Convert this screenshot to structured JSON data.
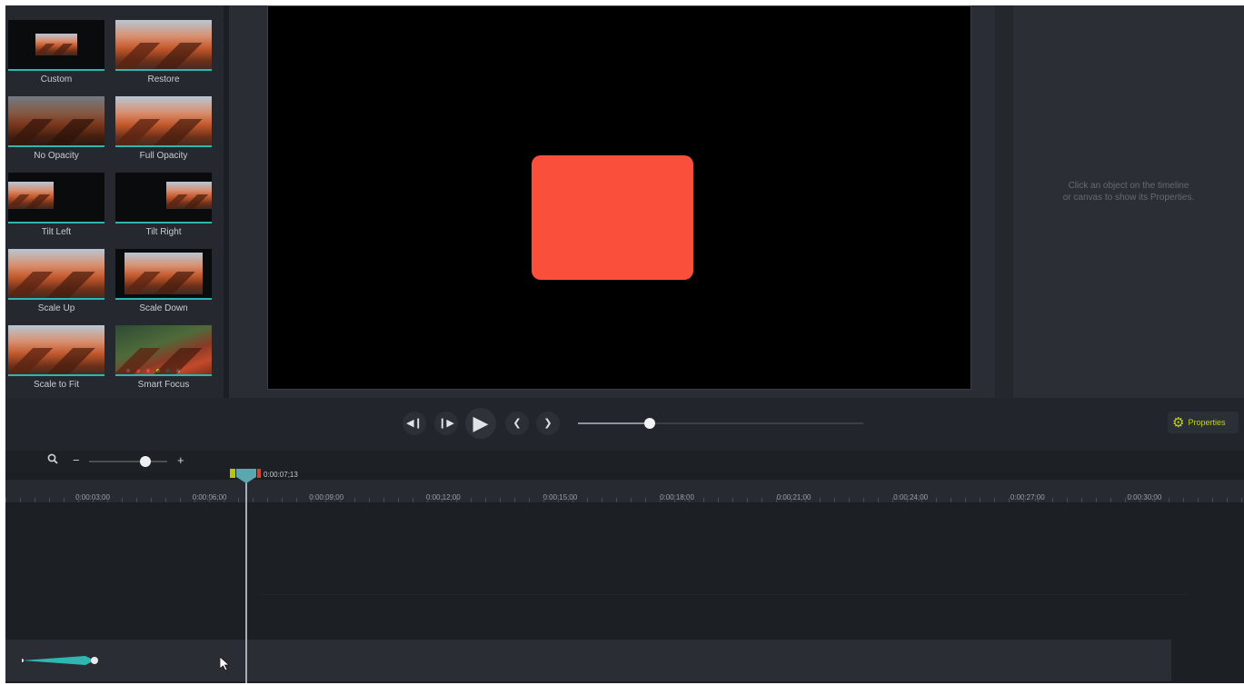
{
  "animations": [
    {
      "label": "Custom",
      "variant": "custom"
    },
    {
      "label": "Restore",
      "variant": "full"
    },
    {
      "label": "No Opacity",
      "variant": "dim"
    },
    {
      "label": "Full Opacity",
      "variant": "full"
    },
    {
      "label": "Tilt Left",
      "variant": "tilt-left"
    },
    {
      "label": "Tilt Right",
      "variant": "tilt-right"
    },
    {
      "label": "Scale Up",
      "variant": "full"
    },
    {
      "label": "Scale Down",
      "variant": "scale-down"
    },
    {
      "label": "Scale to Fit",
      "variant": "full"
    },
    {
      "label": "Smart Focus",
      "variant": "forest"
    }
  ],
  "properties": {
    "hint_line1": "Click an object on the timeline",
    "hint_line2": "or canvas to show its Properties.",
    "button_label": "Properties",
    "button_icon": "gear-icon"
  },
  "playback": {
    "buttons": [
      {
        "name": "step-back-button",
        "icon": "step-back-icon",
        "glyph": "◀❙"
      },
      {
        "name": "step-forward-button",
        "icon": "step-forward-icon",
        "glyph": "❙▶"
      },
      {
        "name": "play-button",
        "icon": "play-icon",
        "glyph": "▶"
      },
      {
        "name": "previous-button",
        "icon": "chevron-left-icon",
        "glyph": "❮"
      },
      {
        "name": "next-button",
        "icon": "chevron-right-icon",
        "glyph": "❯"
      }
    ],
    "scrubber_fraction": 0.25
  },
  "zoom": {
    "minus": "−",
    "plus": "+",
    "level_fraction": 0.72
  },
  "timeline": {
    "playhead_time": "0:00:07;13",
    "ticks": [
      "0:00:03;00",
      "0:00:06;00",
      "0:00:09;00",
      "0:00:12;00",
      "0:00:15;00",
      "0:00:18;00",
      "0:00:21;00",
      "0:00:24;00",
      "0:00:27;00",
      "0:00:30;00"
    ]
  },
  "colors": {
    "canvas_object": "#fa4f3b",
    "accent_teal": "#2eb7b0",
    "accent_lime": "#c3d11e"
  }
}
